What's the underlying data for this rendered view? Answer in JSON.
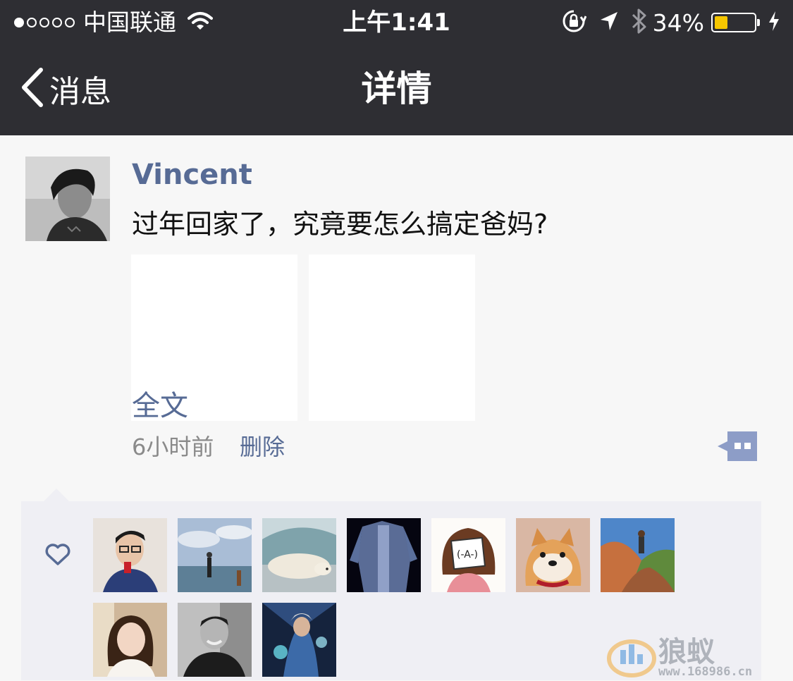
{
  "status_bar": {
    "carrier": "中国联通",
    "time": "上午1:41",
    "battery_pct": "34%",
    "battery_level": 0.34,
    "signal_bars": 1,
    "signal_total": 5
  },
  "nav": {
    "back_label": "消息",
    "title": "详情"
  },
  "post": {
    "author": "Vincent",
    "text": "过年回家了，究竟要怎么搞定爸妈?",
    "full_text_label": "全文",
    "time_ago": "6小时前",
    "delete_label": "删除"
  },
  "likes": {
    "count": 10
  },
  "watermark": {
    "brand": "狼蚁",
    "site": "www.168986.cn"
  },
  "colors": {
    "header_bg": "#2e2e33",
    "link_blue": "#576b95",
    "battery_fill": "#f5c600",
    "likes_bg": "#efeff4"
  }
}
